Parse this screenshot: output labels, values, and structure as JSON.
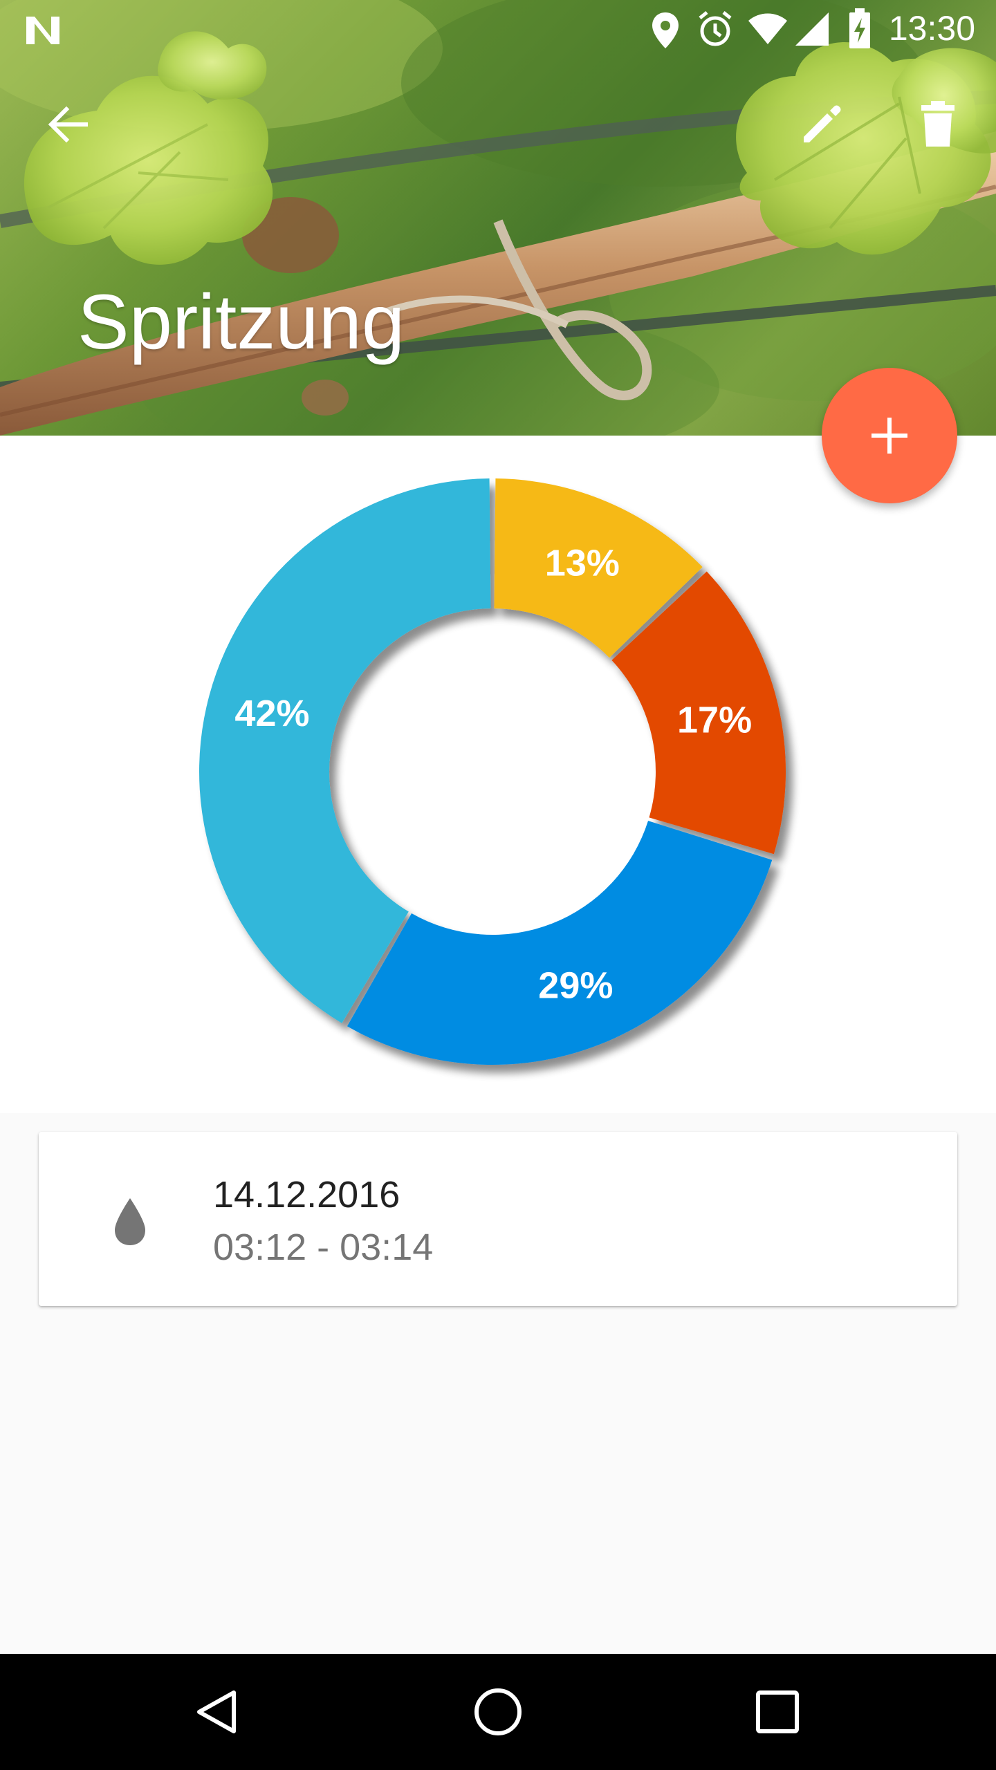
{
  "status_bar": {
    "time": "13:30",
    "icons": [
      "notification-n-icon",
      "location-icon",
      "alarm-icon",
      "wifi-icon",
      "signal-icon",
      "battery-charging-icon"
    ]
  },
  "toolbar": {
    "back_icon": "arrow-back-icon",
    "edit_icon": "pencil-icon",
    "delete_icon": "trash-icon"
  },
  "header": {
    "title": "Spritzung"
  },
  "fab": {
    "icon": "plus-icon",
    "color": "#ff6a45"
  },
  "chart_data": {
    "type": "pie",
    "donut": true,
    "slices": [
      {
        "label": "13%",
        "value": 13,
        "color": "#f6b917"
      },
      {
        "label": "17%",
        "value": 17,
        "color": "#e34a00"
      },
      {
        "label": "29%",
        "value": 29,
        "color": "#048ce2"
      },
      {
        "label": "42%",
        "value": 42,
        "color": "#33b7da"
      }
    ]
  },
  "entries": [
    {
      "icon": "water-drop-icon",
      "date": "14.12.2016",
      "time_range": "03:12 - 03:14"
    }
  ],
  "nav_bar": {
    "back": "nav-back-icon",
    "home": "nav-home-icon",
    "recents": "nav-recents-icon"
  }
}
